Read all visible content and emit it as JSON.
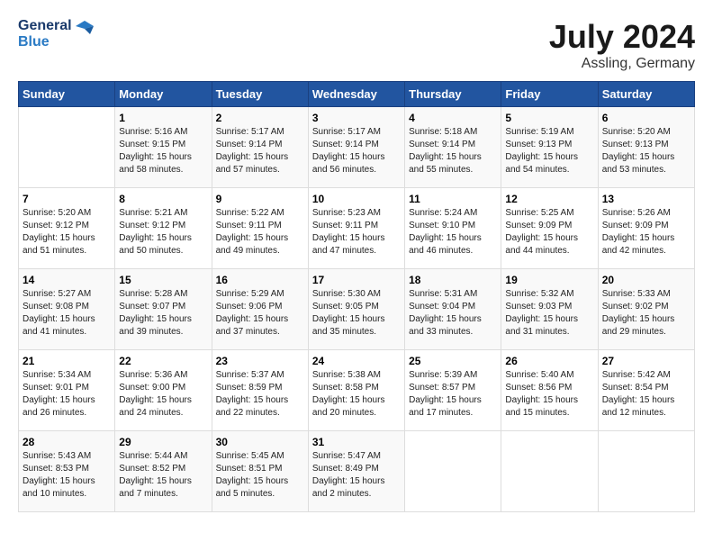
{
  "logo": {
    "line1": "General",
    "line2": "Blue"
  },
  "title": "July 2024",
  "location": "Assling, Germany",
  "weekdays": [
    "Sunday",
    "Monday",
    "Tuesday",
    "Wednesday",
    "Thursday",
    "Friday",
    "Saturday"
  ],
  "weeks": [
    [
      {
        "day": "",
        "sunrise": "",
        "sunset": "",
        "daylight": ""
      },
      {
        "day": "1",
        "sunrise": "Sunrise: 5:16 AM",
        "sunset": "Sunset: 9:15 PM",
        "daylight": "Daylight: 15 hours and 58 minutes."
      },
      {
        "day": "2",
        "sunrise": "Sunrise: 5:17 AM",
        "sunset": "Sunset: 9:14 PM",
        "daylight": "Daylight: 15 hours and 57 minutes."
      },
      {
        "day": "3",
        "sunrise": "Sunrise: 5:17 AM",
        "sunset": "Sunset: 9:14 PM",
        "daylight": "Daylight: 15 hours and 56 minutes."
      },
      {
        "day": "4",
        "sunrise": "Sunrise: 5:18 AM",
        "sunset": "Sunset: 9:14 PM",
        "daylight": "Daylight: 15 hours and 55 minutes."
      },
      {
        "day": "5",
        "sunrise": "Sunrise: 5:19 AM",
        "sunset": "Sunset: 9:13 PM",
        "daylight": "Daylight: 15 hours and 54 minutes."
      },
      {
        "day": "6",
        "sunrise": "Sunrise: 5:20 AM",
        "sunset": "Sunset: 9:13 PM",
        "daylight": "Daylight: 15 hours and 53 minutes."
      }
    ],
    [
      {
        "day": "7",
        "sunrise": "Sunrise: 5:20 AM",
        "sunset": "Sunset: 9:12 PM",
        "daylight": "Daylight: 15 hours and 51 minutes."
      },
      {
        "day": "8",
        "sunrise": "Sunrise: 5:21 AM",
        "sunset": "Sunset: 9:12 PM",
        "daylight": "Daylight: 15 hours and 50 minutes."
      },
      {
        "day": "9",
        "sunrise": "Sunrise: 5:22 AM",
        "sunset": "Sunset: 9:11 PM",
        "daylight": "Daylight: 15 hours and 49 minutes."
      },
      {
        "day": "10",
        "sunrise": "Sunrise: 5:23 AM",
        "sunset": "Sunset: 9:11 PM",
        "daylight": "Daylight: 15 hours and 47 minutes."
      },
      {
        "day": "11",
        "sunrise": "Sunrise: 5:24 AM",
        "sunset": "Sunset: 9:10 PM",
        "daylight": "Daylight: 15 hours and 46 minutes."
      },
      {
        "day": "12",
        "sunrise": "Sunrise: 5:25 AM",
        "sunset": "Sunset: 9:09 PM",
        "daylight": "Daylight: 15 hours and 44 minutes."
      },
      {
        "day": "13",
        "sunrise": "Sunrise: 5:26 AM",
        "sunset": "Sunset: 9:09 PM",
        "daylight": "Daylight: 15 hours and 42 minutes."
      }
    ],
    [
      {
        "day": "14",
        "sunrise": "Sunrise: 5:27 AM",
        "sunset": "Sunset: 9:08 PM",
        "daylight": "Daylight: 15 hours and 41 minutes."
      },
      {
        "day": "15",
        "sunrise": "Sunrise: 5:28 AM",
        "sunset": "Sunset: 9:07 PM",
        "daylight": "Daylight: 15 hours and 39 minutes."
      },
      {
        "day": "16",
        "sunrise": "Sunrise: 5:29 AM",
        "sunset": "Sunset: 9:06 PM",
        "daylight": "Daylight: 15 hours and 37 minutes."
      },
      {
        "day": "17",
        "sunrise": "Sunrise: 5:30 AM",
        "sunset": "Sunset: 9:05 PM",
        "daylight": "Daylight: 15 hours and 35 minutes."
      },
      {
        "day": "18",
        "sunrise": "Sunrise: 5:31 AM",
        "sunset": "Sunset: 9:04 PM",
        "daylight": "Daylight: 15 hours and 33 minutes."
      },
      {
        "day": "19",
        "sunrise": "Sunrise: 5:32 AM",
        "sunset": "Sunset: 9:03 PM",
        "daylight": "Daylight: 15 hours and 31 minutes."
      },
      {
        "day": "20",
        "sunrise": "Sunrise: 5:33 AM",
        "sunset": "Sunset: 9:02 PM",
        "daylight": "Daylight: 15 hours and 29 minutes."
      }
    ],
    [
      {
        "day": "21",
        "sunrise": "Sunrise: 5:34 AM",
        "sunset": "Sunset: 9:01 PM",
        "daylight": "Daylight: 15 hours and 26 minutes."
      },
      {
        "day": "22",
        "sunrise": "Sunrise: 5:36 AM",
        "sunset": "Sunset: 9:00 PM",
        "daylight": "Daylight: 15 hours and 24 minutes."
      },
      {
        "day": "23",
        "sunrise": "Sunrise: 5:37 AM",
        "sunset": "Sunset: 8:59 PM",
        "daylight": "Daylight: 15 hours and 22 minutes."
      },
      {
        "day": "24",
        "sunrise": "Sunrise: 5:38 AM",
        "sunset": "Sunset: 8:58 PM",
        "daylight": "Daylight: 15 hours and 20 minutes."
      },
      {
        "day": "25",
        "sunrise": "Sunrise: 5:39 AM",
        "sunset": "Sunset: 8:57 PM",
        "daylight": "Daylight: 15 hours and 17 minutes."
      },
      {
        "day": "26",
        "sunrise": "Sunrise: 5:40 AM",
        "sunset": "Sunset: 8:56 PM",
        "daylight": "Daylight: 15 hours and 15 minutes."
      },
      {
        "day": "27",
        "sunrise": "Sunrise: 5:42 AM",
        "sunset": "Sunset: 8:54 PM",
        "daylight": "Daylight: 15 hours and 12 minutes."
      }
    ],
    [
      {
        "day": "28",
        "sunrise": "Sunrise: 5:43 AM",
        "sunset": "Sunset: 8:53 PM",
        "daylight": "Daylight: 15 hours and 10 minutes."
      },
      {
        "day": "29",
        "sunrise": "Sunrise: 5:44 AM",
        "sunset": "Sunset: 8:52 PM",
        "daylight": "Daylight: 15 hours and 7 minutes."
      },
      {
        "day": "30",
        "sunrise": "Sunrise: 5:45 AM",
        "sunset": "Sunset: 8:51 PM",
        "daylight": "Daylight: 15 hours and 5 minutes."
      },
      {
        "day": "31",
        "sunrise": "Sunrise: 5:47 AM",
        "sunset": "Sunset: 8:49 PM",
        "daylight": "Daylight: 15 hours and 2 minutes."
      },
      {
        "day": "",
        "sunrise": "",
        "sunset": "",
        "daylight": ""
      },
      {
        "day": "",
        "sunrise": "",
        "sunset": "",
        "daylight": ""
      },
      {
        "day": "",
        "sunrise": "",
        "sunset": "",
        "daylight": ""
      }
    ]
  ]
}
